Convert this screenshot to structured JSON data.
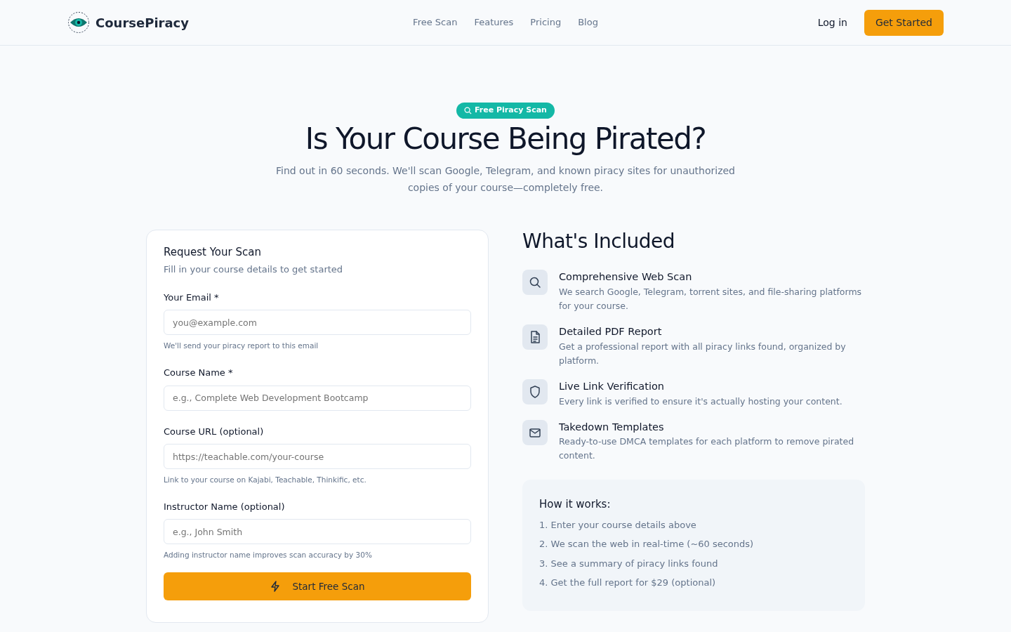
{
  "navbar": {
    "brand": "CoursePiracy",
    "links": [
      "Free Scan",
      "Features",
      "Pricing",
      "Blog"
    ],
    "login": "Log in",
    "cta": "Get Started"
  },
  "hero": {
    "badge": "Free Piracy Scan",
    "title": "Is Your Course Being Pirated?",
    "subtitle": "Find out in 60 seconds. We'll scan Google, Telegram, and known piracy sites for unauthorized copies of your course—completely free."
  },
  "form": {
    "title": "Request Your Scan",
    "subtitle": "Fill in your course details to get started",
    "fields": [
      {
        "label": "Your Email *",
        "placeholder": "you@example.com",
        "hint": "We'll send your piracy report to this email"
      },
      {
        "label": "Course Name *",
        "placeholder": "e.g., Complete Web Development Bootcamp"
      },
      {
        "label": "Course URL (optional)",
        "placeholder": "https://teachable.com/your-course",
        "hint": "Link to your course on Kajabi, Teachable, Thinkific, etc."
      },
      {
        "label": "Instructor Name (optional)",
        "placeholder": "e.g., John Smith",
        "hint": "Adding instructor name improves scan accuracy by 30%"
      }
    ],
    "submit": "Start Free Scan"
  },
  "included": {
    "title": "What's Included",
    "items": [
      {
        "kind": "search",
        "title": "Comprehensive Web Scan",
        "text": "We search Google, Telegram, torrent sites, and file-sharing platforms for your course."
      },
      {
        "kind": "document",
        "title": "Detailed PDF Report",
        "text": "Get a professional report with all piracy links found, organized by platform."
      },
      {
        "kind": "shield",
        "title": "Live Link Verification",
        "text": "Every link is verified to ensure it's actually hosting your content."
      },
      {
        "kind": "mail",
        "title": "Takedown Templates",
        "text": "Ready-to-use DMCA templates for each platform to remove pirated content."
      }
    ]
  },
  "how": {
    "title": "How it works:",
    "steps": [
      "1. Enter your course details above",
      "2. We scan the web in real-time (~60 seconds)",
      "3. See a summary of piracy links found",
      "4. Get the full report for $29 (optional)"
    ]
  }
}
